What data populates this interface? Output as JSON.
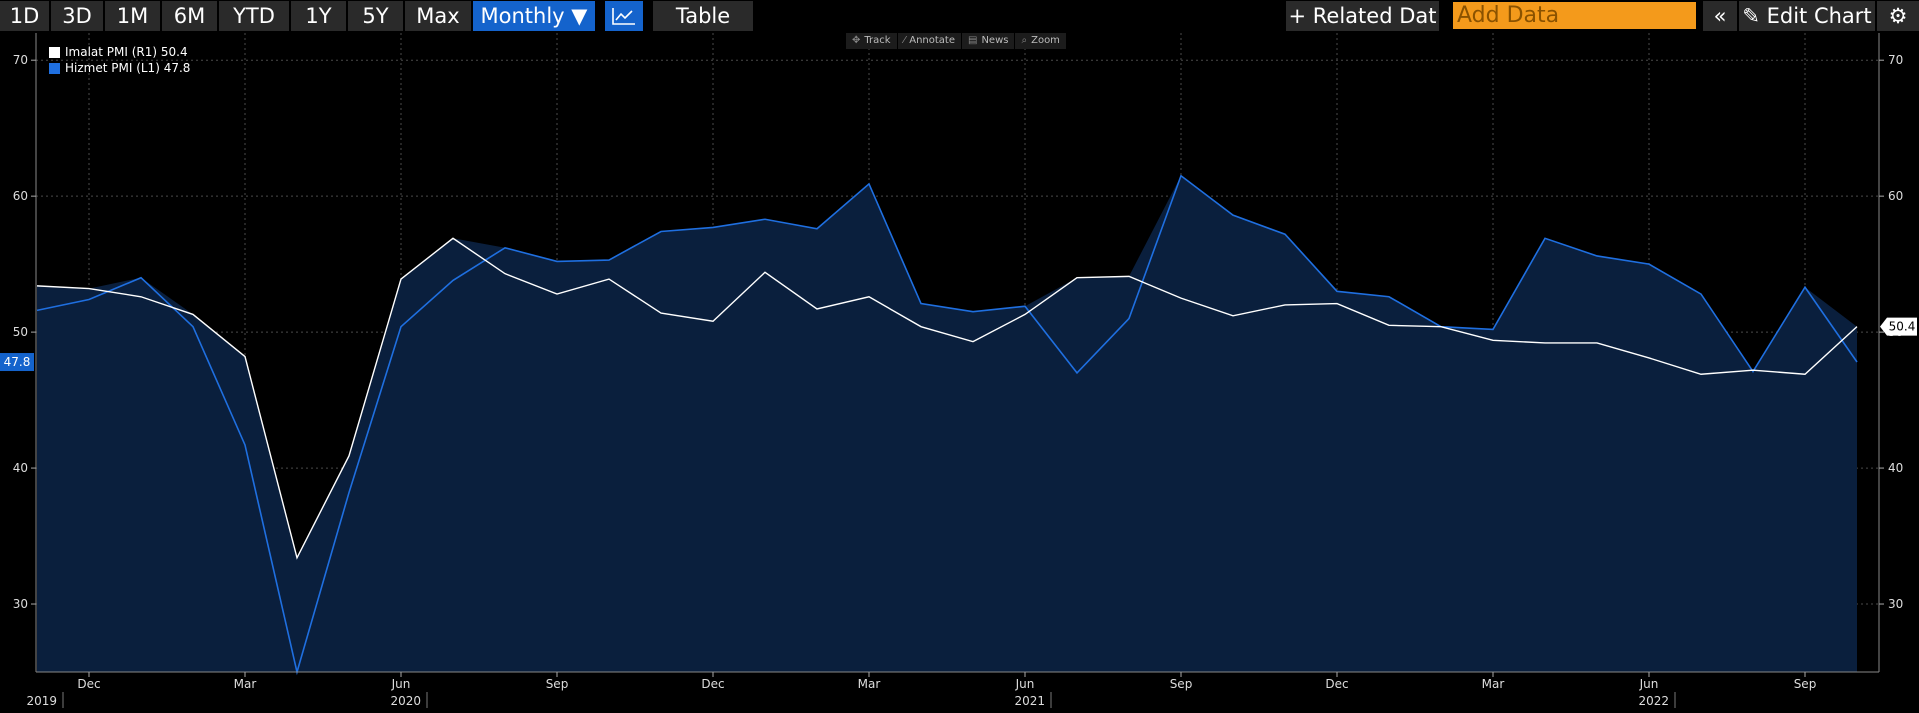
{
  "toolbar": {
    "ranges": [
      "1D",
      "3D",
      "1M",
      "6M",
      "YTD",
      "1Y",
      "5Y",
      "Max"
    ],
    "frequency": "Monthly ▼",
    "table_label": "Table",
    "related_label": "+ Related Dat",
    "add_data_placeholder": "Add Data",
    "collapse_label": "«",
    "edit_label": "✎ Edit Chart",
    "settings_label": "⚙"
  },
  "chart_tools": [
    {
      "icon": "✥",
      "label": "Track"
    },
    {
      "icon": "⁄",
      "label": "Annotate"
    },
    {
      "icon": "▤",
      "label": "News"
    },
    {
      "icon": "⌕",
      "label": "Zoom"
    }
  ],
  "colors": {
    "background": "#000000",
    "manufacturing": "#ffffff",
    "services": "#1f6fe0",
    "area_fill": "#0a1f3d",
    "grid": "#4a4a4a",
    "label_white_bg": "#ffffff",
    "label_blue_bg": "#1463cc"
  },
  "chart_data": {
    "type": "line",
    "x": [
      "2019-11",
      "2019-12",
      "2020-01",
      "2020-02",
      "2020-03",
      "2020-04",
      "2020-05",
      "2020-06",
      "2020-07",
      "2020-08",
      "2020-09",
      "2020-10",
      "2020-11",
      "2020-12",
      "2021-01",
      "2021-02",
      "2021-03",
      "2021-04",
      "2021-05",
      "2021-06",
      "2021-07",
      "2021-08",
      "2021-09",
      "2021-10",
      "2021-11",
      "2021-12",
      "2022-01",
      "2022-02",
      "2022-03",
      "2022-04",
      "2022-05",
      "2022-06",
      "2022-07",
      "2022-08",
      "2022-09",
      "2022-10"
    ],
    "series": [
      {
        "name": "Imalat PMI (R1)",
        "last": "50.4",
        "axis": "right",
        "values": [
          53.4,
          53.2,
          52.6,
          51.3,
          48.2,
          33.4,
          40.9,
          53.9,
          56.9,
          54.3,
          52.8,
          53.9,
          51.4,
          50.8,
          54.4,
          51.7,
          52.6,
          50.4,
          49.3,
          51.3,
          54.0,
          54.1,
          52.5,
          51.2,
          52.0,
          52.1,
          50.5,
          50.4,
          49.4,
          49.2,
          49.2,
          48.1,
          46.9,
          47.2,
          46.9,
          50.4
        ]
      },
      {
        "name": "Hizmet PMI (L1)",
        "last": "47.8",
        "axis": "left",
        "values": [
          51.6,
          52.4,
          54.0,
          50.4,
          41.7,
          25.0,
          38.2,
          50.4,
          53.8,
          56.2,
          55.2,
          55.3,
          57.4,
          57.7,
          58.3,
          57.6,
          60.9,
          52.1,
          51.5,
          51.9,
          47.0,
          51.0,
          61.5,
          58.6,
          57.2,
          53.0,
          52.6,
          50.4,
          50.2,
          56.9,
          55.6,
          55.0,
          52.8,
          47.1,
          53.3,
          47.8
        ]
      }
    ],
    "left_axis": {
      "ticks": [
        30,
        40,
        50,
        60,
        70
      ],
      "ylim": [
        25,
        72
      ],
      "badge": "47.8"
    },
    "right_axis": {
      "ticks": [
        30,
        40,
        50,
        60,
        70
      ],
      "ylim": [
        25,
        72
      ],
      "badge": "50.4"
    },
    "month_ticks": [
      {
        "index": 1,
        "label": "Dec"
      },
      {
        "index": 4,
        "label": "Mar"
      },
      {
        "index": 7,
        "label": "Jun"
      },
      {
        "index": 10,
        "label": "Sep"
      },
      {
        "index": 13,
        "label": "Dec"
      },
      {
        "index": 16,
        "label": "Mar"
      },
      {
        "index": 19,
        "label": "Jun"
      },
      {
        "index": 22,
        "label": "Sep"
      },
      {
        "index": 25,
        "label": "Dec"
      },
      {
        "index": 28,
        "label": "Mar"
      },
      {
        "index": 31,
        "label": "Jun"
      },
      {
        "index": 34,
        "label": "Sep"
      }
    ],
    "year_ticks": [
      {
        "index": 0.5,
        "label": "2019"
      },
      {
        "index": 7.5,
        "label": "2020"
      },
      {
        "index": 19.5,
        "label": "2021"
      },
      {
        "index": 31.5,
        "label": "2022"
      }
    ],
    "grid": true,
    "legend_position": "top-left"
  }
}
